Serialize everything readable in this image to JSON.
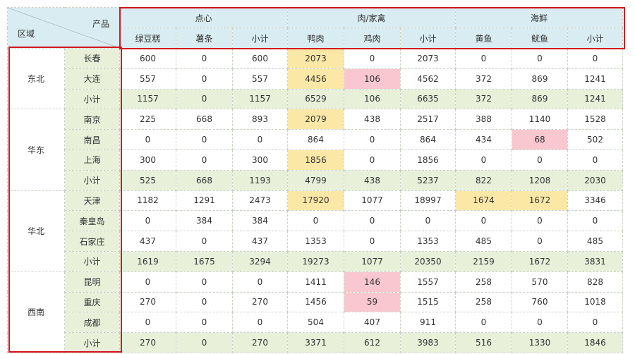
{
  "header": {
    "corner": {
      "product": "产品",
      "region": "区域"
    },
    "groups": [
      {
        "label": "点心",
        "cols": [
          "绿豆糕",
          "薯条",
          "小计"
        ]
      },
      {
        "label": "肉/家禽",
        "cols": [
          "鸭肉",
          "鸡肉",
          "小计"
        ]
      },
      {
        "label": "海鲜",
        "cols": [
          "黄鱼",
          "鱿鱼",
          "小计"
        ]
      }
    ]
  },
  "rows": [
    {
      "region": "东北",
      "city": "长春",
      "values": [
        "600",
        "0",
        "600",
        "2073",
        "0",
        "2073",
        "0",
        "0",
        "0"
      ]
    },
    {
      "city": "大连",
      "values": [
        "557",
        "0",
        "557",
        "4456",
        "106",
        "4562",
        "372",
        "869",
        "1241"
      ]
    },
    {
      "city": "小计",
      "values": [
        "1157",
        "0",
        "1157",
        "6529",
        "106",
        "6635",
        "372",
        "869",
        "1241"
      ]
    },
    {
      "region": "华东",
      "city": "南京",
      "values": [
        "225",
        "668",
        "893",
        "2079",
        "438",
        "2517",
        "388",
        "1140",
        "1528"
      ]
    },
    {
      "city": "南昌",
      "values": [
        "0",
        "0",
        "0",
        "864",
        "0",
        "864",
        "434",
        "68",
        "502"
      ]
    },
    {
      "city": "上海",
      "values": [
        "300",
        "0",
        "300",
        "1856",
        "0",
        "1856",
        "0",
        "0",
        "0"
      ]
    },
    {
      "city": "小计",
      "values": [
        "525",
        "668",
        "1193",
        "4799",
        "438",
        "5237",
        "822",
        "1208",
        "2030"
      ]
    },
    {
      "region": "华北",
      "city": "天津",
      "values": [
        "1182",
        "1291",
        "2473",
        "17920",
        "1077",
        "18997",
        "1674",
        "1672",
        "3346"
      ]
    },
    {
      "city": "秦皇岛",
      "values": [
        "0",
        "384",
        "384",
        "0",
        "0",
        "0",
        "0",
        "0",
        "0"
      ]
    },
    {
      "city": "石家庄",
      "values": [
        "437",
        "0",
        "437",
        "1353",
        "0",
        "1353",
        "485",
        "0",
        "485"
      ]
    },
    {
      "city": "小计",
      "values": [
        "1619",
        "1675",
        "3294",
        "19273",
        "1077",
        "20350",
        "2159",
        "1672",
        "3831"
      ]
    },
    {
      "region": "西南",
      "city": "昆明",
      "values": [
        "0",
        "0",
        "0",
        "1411",
        "146",
        "1557",
        "258",
        "570",
        "828"
      ]
    },
    {
      "city": "重庆",
      "values": [
        "270",
        "0",
        "270",
        "1456",
        "59",
        "1515",
        "258",
        "760",
        "1018"
      ]
    },
    {
      "city": "成都",
      "values": [
        "0",
        "0",
        "0",
        "504",
        "407",
        "911",
        "0",
        "0",
        "0"
      ]
    },
    {
      "city": "小计",
      "values": [
        "270",
        "0",
        "270",
        "3371",
        "612",
        "3983",
        "516",
        "1330",
        "1846"
      ]
    }
  ],
  "colors": {
    "header_bg": "#d8ecf2",
    "subtotal_bg": "#e8f0da",
    "highlight_yellow": "#fbe8a6",
    "highlight_pink": "#f9c7cf",
    "box_border": "#d4161e"
  }
}
